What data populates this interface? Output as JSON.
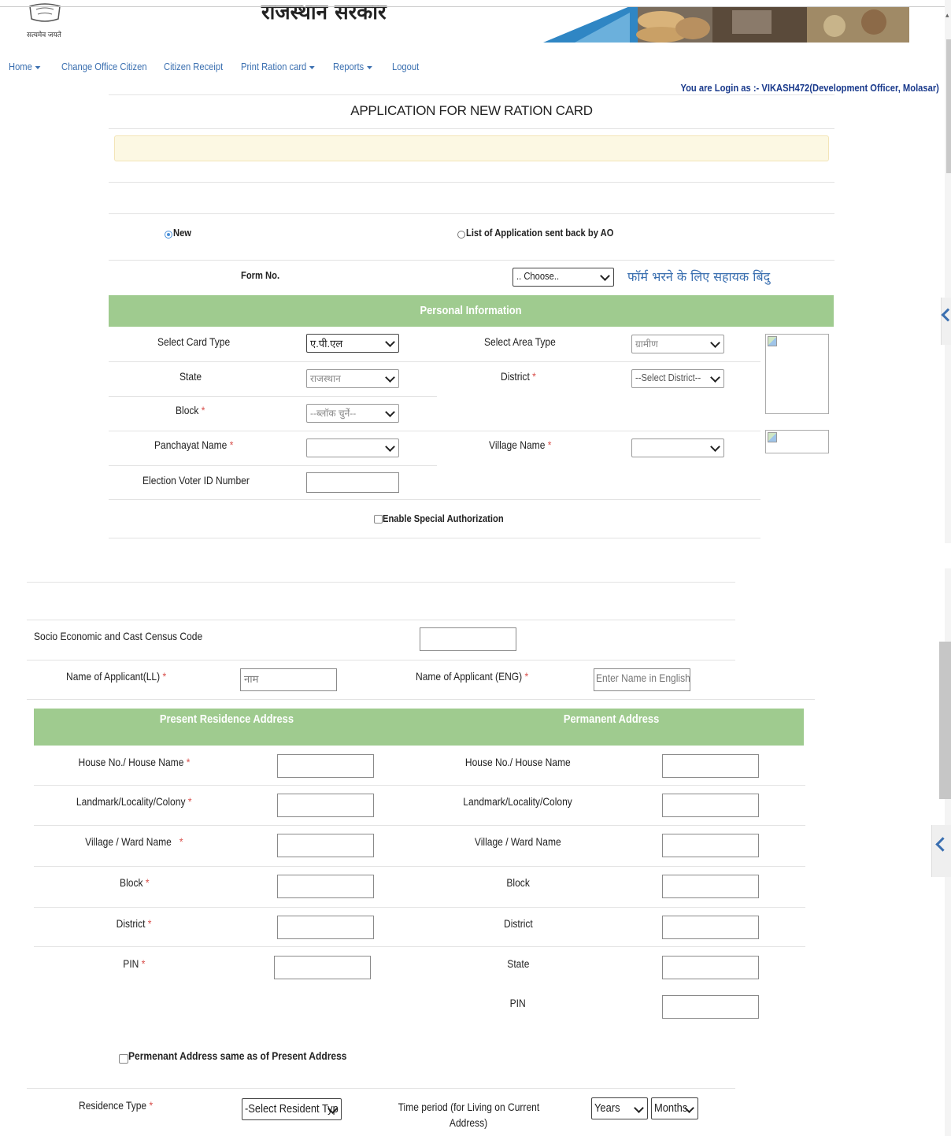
{
  "header": {
    "emblem_motto": "सत्यमेव जयते",
    "govt_title": "राजस्थान सरकार",
    "login_info": "You are Login as :- VIKASH472(Development Officer, Molasar)"
  },
  "nav": {
    "items": [
      {
        "label": "Home",
        "dropdown": true
      },
      {
        "label": "Change Office Citizen",
        "dropdown": false
      },
      {
        "label": "Citizen Receipt",
        "dropdown": false
      },
      {
        "label": "Print Ration card",
        "dropdown": true
      },
      {
        "label": "Reports",
        "dropdown": true
      },
      {
        "label": "Logout",
        "dropdown": false
      }
    ]
  },
  "form": {
    "title": "APPLICATION FOR NEW RATION CARD",
    "radio_new": "New",
    "radio_new_selected": true,
    "radio_sentback": "List of Application sent back by AO",
    "form_no_label": "Form No.",
    "form_no_select": ".. Choose..",
    "help_link": "फॉर्म भरने के लिए सहायक बिंदु"
  },
  "personal": {
    "heading": "Personal Information",
    "card_type_label": "Select Card Type",
    "card_type_value": "ए.पी.एल",
    "area_type_label": "Select Area Type",
    "area_type_value": "ग्रामीण",
    "state_label": "State",
    "state_value": "राजस्थान",
    "district_label": "District",
    "district_value": "--Select District--",
    "block_label": "Block",
    "block_value": "--ब्लॉक चुनेंं--",
    "panchayat_label": "Panchayat Name",
    "village_label": "Village Name",
    "voter_label": "Election Voter ID Number",
    "special_auth_label": "Enable Special Authorization",
    "required_mark": "*"
  },
  "applicant": {
    "secc_label": "Socio Economic and Cast Census Code",
    "name_ll_label": "Name of Applicant(LL)",
    "name_ll_placeholder": "नाम",
    "name_eng_label": "Name of Applicant (ENG)",
    "name_eng_placeholder": "Enter Name in English"
  },
  "address": {
    "present_heading": "Present Residence Address",
    "permanent_heading": "Permanent Address",
    "present_fields": [
      {
        "label": "House No./ House Name",
        "required": true
      },
      {
        "label": "Landmark/Locality/Colony",
        "required": true
      },
      {
        "label": "Village / Ward Name",
        "required": true
      },
      {
        "label": "Block",
        "required": true
      },
      {
        "label": "District",
        "required": true
      },
      {
        "label": "PIN",
        "required": true
      }
    ],
    "permanent_fields": [
      {
        "label": "House No./ House Name"
      },
      {
        "label": "Landmark/Locality/Colony"
      },
      {
        "label": "Village / Ward Name"
      },
      {
        "label": "Block"
      },
      {
        "label": "District"
      },
      {
        "label": "State"
      },
      {
        "label": "PIN"
      }
    ],
    "same_address_label": "Permenant Address same as of Present Address"
  },
  "residence": {
    "type_label": "Residence Type",
    "type_value": "-Select Resident Typ",
    "period_label_line1": "Time period (for Living on Current",
    "period_label_line2": "Address)",
    "years_value": "Years",
    "months_value": "Months"
  },
  "colors": {
    "green_header": "#9fcb8f",
    "nav_link": "#3a6fb0",
    "login_text": "#1a3a8c",
    "alert_bg": "#fcf8e3",
    "required": "#d9534f"
  }
}
